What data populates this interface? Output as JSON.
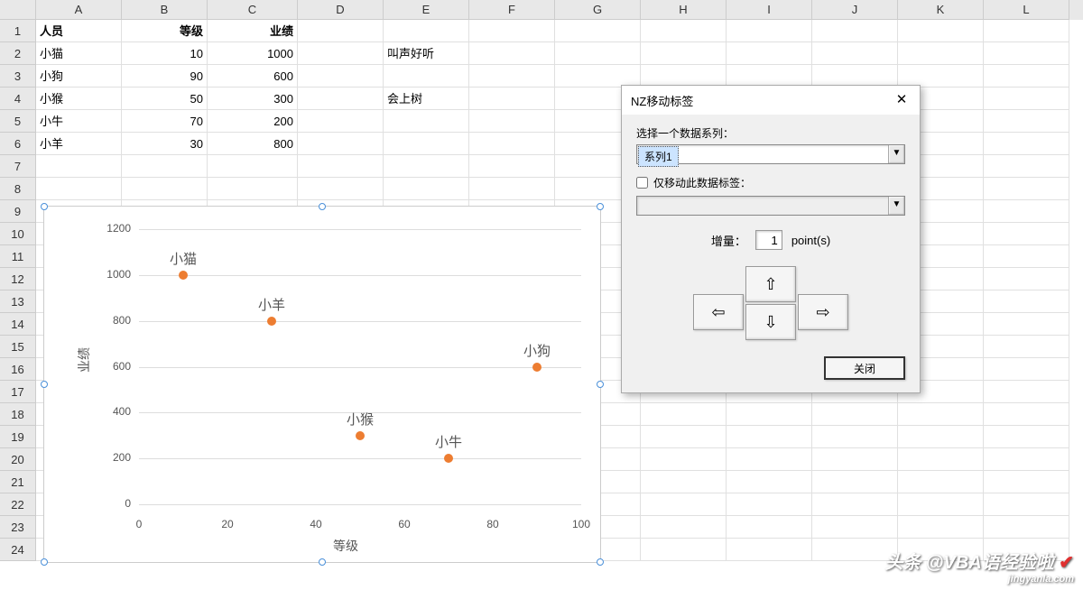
{
  "columns": [
    "A",
    "B",
    "C",
    "D",
    "E",
    "F",
    "G",
    "H",
    "I",
    "J",
    "K",
    "L"
  ],
  "row_labels": [
    "1",
    "2",
    "3",
    "4",
    "5",
    "6",
    "7",
    "8",
    "9",
    "10",
    "11",
    "12",
    "13",
    "14",
    "15",
    "16",
    "17",
    "18",
    "19",
    "20",
    "21",
    "22",
    "23",
    "24"
  ],
  "headers": {
    "A": "人员",
    "B": "等级",
    "C": "业绩"
  },
  "rows": [
    {
      "A": "小猫",
      "B": "10",
      "C": "1000",
      "E": "叫声好听"
    },
    {
      "A": "小狗",
      "B": "90",
      "C": "600"
    },
    {
      "A": "小猴",
      "B": "50",
      "C": "300",
      "E": "会上树"
    },
    {
      "A": "小牛",
      "B": "70",
      "C": "200"
    },
    {
      "A": "小羊",
      "B": "30",
      "C": "800"
    }
  ],
  "dialog": {
    "title": "NZ移动标签",
    "label_series": "选择一个数据系列：",
    "series_value": "系列1",
    "checkbox_label": "仅移动此数据标签：",
    "secondary_value": "",
    "increment_label": "增量：",
    "increment_value": "1",
    "increment_unit": "point(s)",
    "close_label": "关闭"
  },
  "chart_data": {
    "type": "scatter",
    "xlabel": "等级",
    "ylabel": "业绩",
    "xlim": [
      0,
      100
    ],
    "ylim": [
      0,
      1200
    ],
    "x_ticks": [
      0,
      20,
      40,
      60,
      80,
      100
    ],
    "y_ticks": [
      0,
      200,
      400,
      600,
      800,
      1000,
      1200
    ],
    "series": [
      {
        "name": "系列1",
        "points": [
          {
            "label": "小猫",
            "x": 10,
            "y": 1000
          },
          {
            "label": "小羊",
            "x": 30,
            "y": 800
          },
          {
            "label": "小猴",
            "x": 50,
            "y": 300
          },
          {
            "label": "小牛",
            "x": 70,
            "y": 200
          },
          {
            "label": "小狗",
            "x": 90,
            "y": 600
          }
        ]
      }
    ]
  },
  "watermark": {
    "line1": "头条 @VBA语经验啦",
    "line2": "jingyanla.com"
  }
}
